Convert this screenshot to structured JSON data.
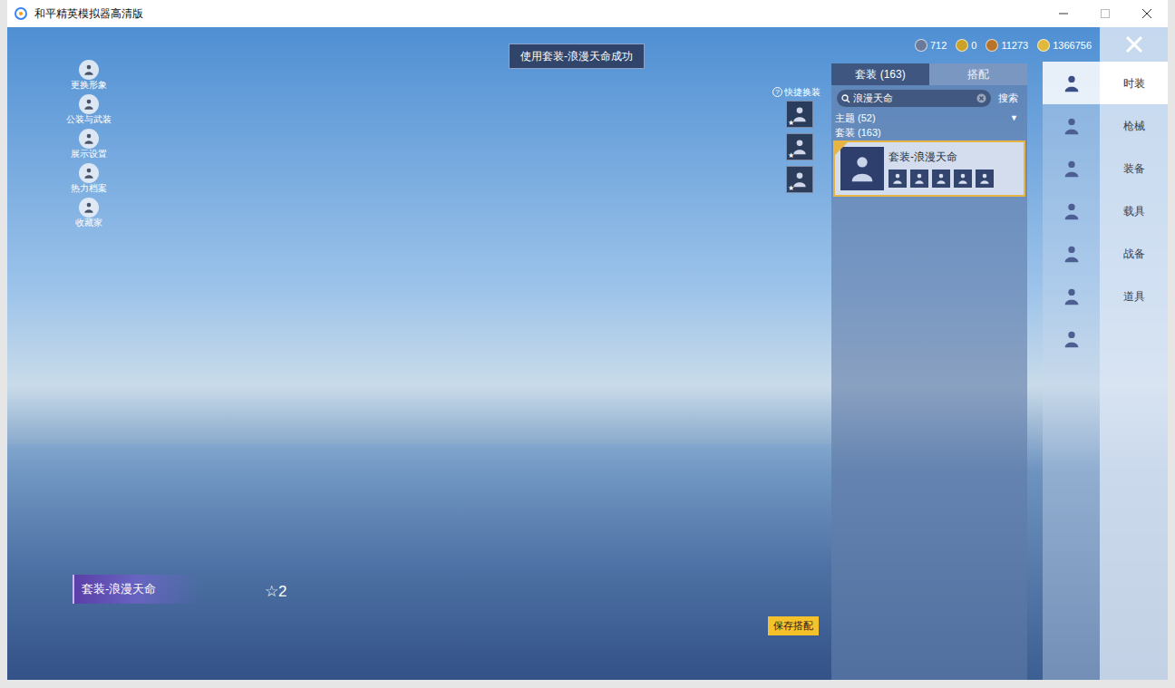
{
  "window": {
    "title": "和平精英模拟器高清版"
  },
  "toast": "使用套装-浪漫天命成功",
  "left_menu": [
    {
      "label": "更换形象"
    },
    {
      "label": "公装与武装"
    },
    {
      "label": "展示设置"
    },
    {
      "label": "热力档案"
    },
    {
      "label": "收藏家"
    }
  ],
  "currencies": [
    {
      "value": "712",
      "color": "#6b7a99"
    },
    {
      "value": "0",
      "color": "#c9a227"
    },
    {
      "value": "11273",
      "color": "#b8742a"
    },
    {
      "value": "1366756",
      "color": "#e0b93a"
    }
  ],
  "quick_change": {
    "help": "?",
    "label": "快捷换装",
    "slots": [
      {
        "star": "★"
      },
      {
        "star": "★"
      },
      {
        "star": "★"
      }
    ]
  },
  "panel": {
    "tabs": [
      {
        "label": "套装 (163)",
        "selected": true
      },
      {
        "label": "搭配",
        "selected": false
      }
    ],
    "search": {
      "value": "浪漫天命",
      "button": "搜索"
    },
    "theme": "主题 (52)",
    "theme_arrow": "▼",
    "category": "套装 (163)",
    "items": [
      {
        "name": "套装-浪漫天命",
        "selected": true
      }
    ]
  },
  "icon_tabs": [
    {
      "selected": true
    },
    {
      "selected": false
    },
    {
      "selected": false
    },
    {
      "selected": false
    },
    {
      "selected": false
    },
    {
      "selected": false
    },
    {
      "selected": false
    }
  ],
  "category_tabs": [
    {
      "label": "时装",
      "selected": true
    },
    {
      "label": "枪械",
      "selected": false
    },
    {
      "label": "装备",
      "selected": false
    },
    {
      "label": "载具",
      "selected": false
    },
    {
      "label": "战备",
      "selected": false
    },
    {
      "label": "道具",
      "selected": false
    }
  ],
  "outfit_label": "套装-浪漫天命",
  "rating": "☆2",
  "save_button": "保存搭配"
}
